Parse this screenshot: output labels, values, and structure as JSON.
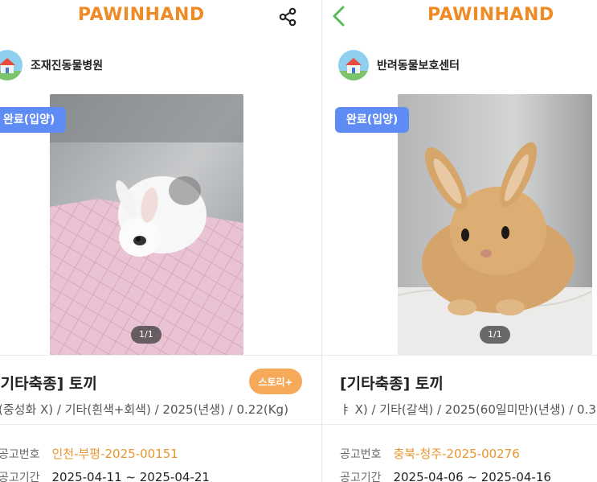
{
  "left": {
    "brand": "PAWINHAND",
    "shelter_name": "조재진동물병원",
    "status_badge": "완료(입양)",
    "photo_counter": "1/1",
    "title": "[기타축종] 토끼",
    "story_button": "스토리+",
    "details": "(중성화 X) / 기타(흰색+회색) / 2025(년생) / 0.22(Kg)",
    "notice_label": "공고번호",
    "notice_value": "인천-부평-2025-00151",
    "period_label": "공고기간",
    "period_value": "2025-04-11 ~ 2025-04-21",
    "icons": {
      "share": "share-icon",
      "avatar": "house-icon"
    }
  },
  "right": {
    "brand": "PAWINHAND",
    "shelter_name": "반려동물보호센터",
    "status_badge": "완료(입양)",
    "photo_counter": "1/1",
    "title": "[기타축종] 토끼",
    "details": "ㅑ X) / 기타(갈색) / 2025(60일미만)(년생) / 0.3",
    "notice_label": "공고번호",
    "notice_value": "충북-청주-2025-00276",
    "period_label": "공고기간",
    "period_value": "2025-04-06 ~ 2025-04-16",
    "icons": {
      "back": "back-arrow-icon",
      "avatar": "house-icon"
    }
  },
  "colors": {
    "brand": "#f08a24",
    "status_badge": "#5f8bf4",
    "story_button": "#f7a95a",
    "notice_value": "#e8962e"
  }
}
